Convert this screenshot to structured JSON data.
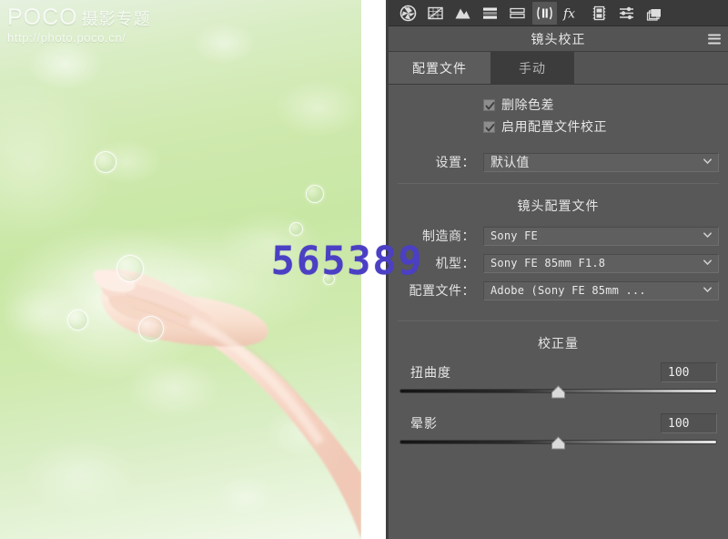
{
  "photo": {
    "watermark": {
      "brand": "POCO",
      "title": "摄影专题",
      "url": "http://photo.poco.cn/"
    },
    "overlay_number": "565389",
    "overlay_number_color": "#4b3fc4",
    "description": "hand-with-bubbles-photo"
  },
  "panel": {
    "title": "镜头校正",
    "menu_icon": "hamburger-icon",
    "toolbar": [
      {
        "name": "basic-adjustments-icon",
        "label": "基本",
        "active": false
      },
      {
        "name": "tone-curve-icon",
        "label": "色调曲线",
        "active": false
      },
      {
        "name": "detail-icon",
        "label": "细节",
        "active": false
      },
      {
        "name": "hsl-grayscale-icon",
        "label": "HSL/灰度",
        "active": false
      },
      {
        "name": "split-toning-icon",
        "label": "分离色调",
        "active": false
      },
      {
        "name": "lens-corrections-icon",
        "label": "镜头校正",
        "active": true
      },
      {
        "name": "effects-fx-icon",
        "label": "效果",
        "active": false
      },
      {
        "name": "camera-calibration-icon",
        "label": "相机校准",
        "active": false
      },
      {
        "name": "presets-icon",
        "label": "预设",
        "active": false
      },
      {
        "name": "snapshots-icon",
        "label": "快照",
        "active": false
      }
    ],
    "tabs": [
      {
        "label": "配置文件",
        "active": true
      },
      {
        "label": "手动",
        "active": false
      }
    ],
    "checkboxes": [
      {
        "label": "删除色差",
        "checked": true
      },
      {
        "label": "启用配置文件校正",
        "checked": true
      }
    ],
    "settings": {
      "label": "设置：",
      "value": "默认值"
    },
    "lens_profile": {
      "title": "镜头配置文件",
      "fields": [
        {
          "label": "制造商：",
          "value": "Sony FE"
        },
        {
          "label": "机型：",
          "value": "Sony FE 85mm F1.8"
        },
        {
          "label": "配置文件：",
          "value": "Adobe (Sony FE 85mm ..."
        }
      ]
    },
    "correction_amount": {
      "title": "校正量",
      "sliders": [
        {
          "label": "扭曲度",
          "value": "100",
          "position_pct": 50
        },
        {
          "label": "晕影",
          "value": "100",
          "position_pct": 50
        }
      ]
    }
  }
}
